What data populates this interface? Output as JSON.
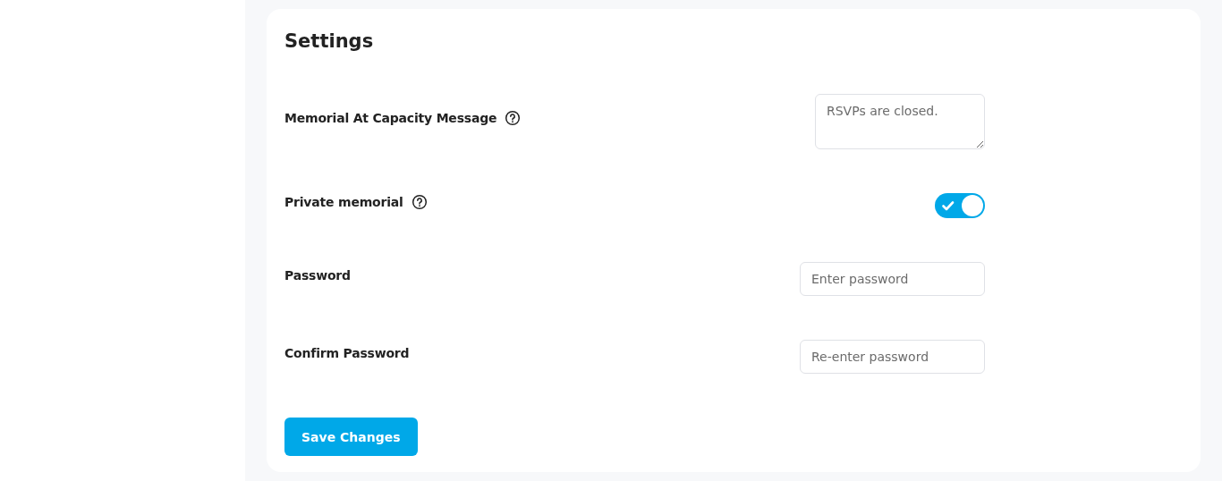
{
  "settings": {
    "title": "Settings",
    "fields": [
      {
        "kind": "textarea",
        "label": "Memorial At Capacity Message",
        "help": true,
        "placeholder": "RSVPs are closed."
      },
      {
        "kind": "toggle",
        "label": "Private memorial",
        "help": true,
        "on": true
      },
      {
        "kind": "input",
        "label": "Password",
        "help": false,
        "placeholder": "Enter password"
      },
      {
        "kind": "input",
        "label": "Confirm Password",
        "help": false,
        "placeholder": "Re-enter password"
      }
    ],
    "save_button": "Save Changes"
  }
}
